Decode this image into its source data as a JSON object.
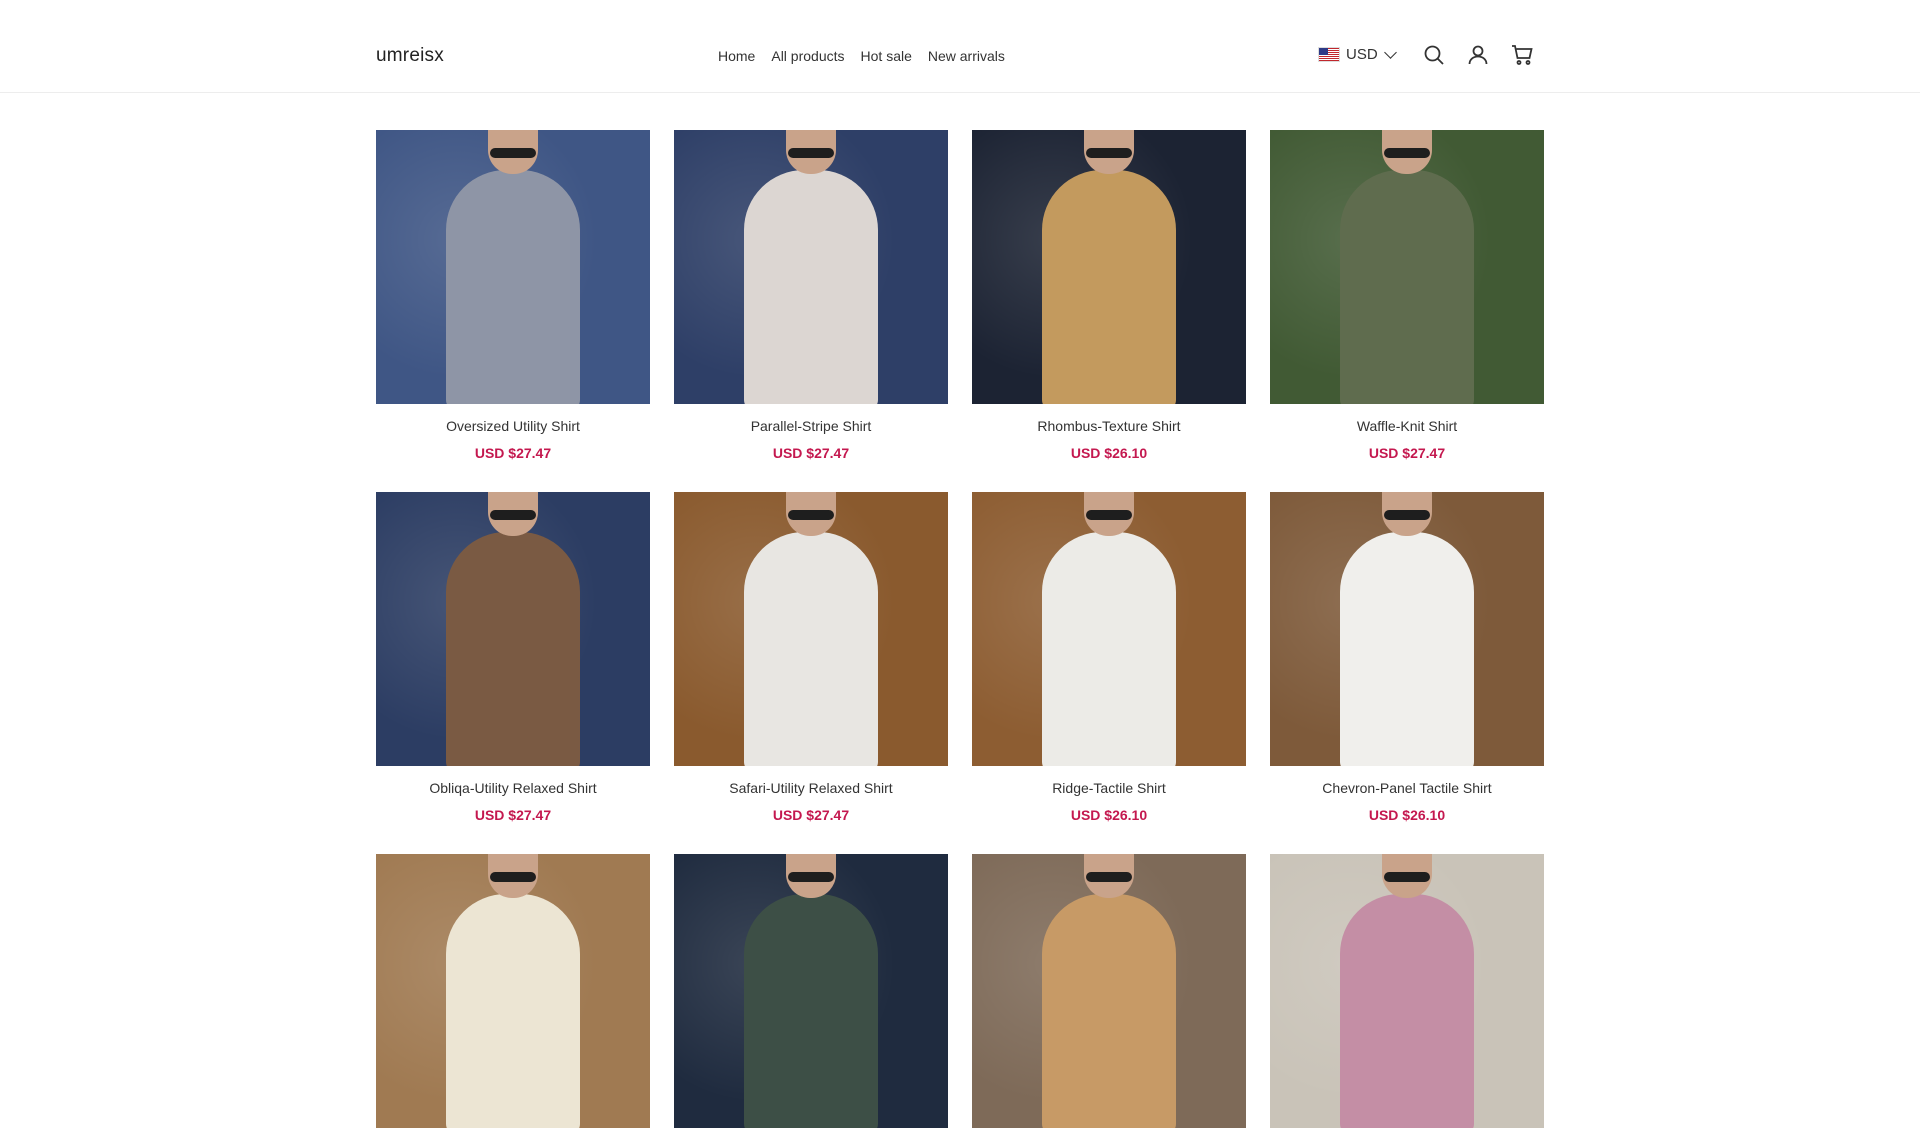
{
  "header": {
    "logo": "umreisx",
    "nav": [
      "Home",
      "All products",
      "Hot sale",
      "New arrivals"
    ],
    "currency": "USD"
  },
  "products": [
    {
      "name": "Oversized Utility Shirt",
      "price": "USD $27.47",
      "bg": "#3f5685",
      "shirt": "#8e95a6"
    },
    {
      "name": "Parallel-Stripe Shirt",
      "price": "USD $27.47",
      "bg": "#2e3f67",
      "shirt": "#dcd6d2"
    },
    {
      "name": "Rhombus-Texture Shirt",
      "price": "USD $26.10",
      "bg": "#1c2333",
      "shirt": "#c39a5e"
    },
    {
      "name": "Waffle-Knit Shirt",
      "price": "USD $27.47",
      "bg": "#415a34",
      "shirt": "#5f6c4e"
    },
    {
      "name": "Obliqa-Utility Relaxed Shirt",
      "price": "USD $27.47",
      "bg": "#2c3d63",
      "shirt": "#7a5a43"
    },
    {
      "name": "Safari-Utility Relaxed Shirt",
      "price": "USD $27.47",
      "bg": "#8a5a2e",
      "shirt": "#e8e6e2"
    },
    {
      "name": "Ridge-Tactile Shirt",
      "price": "USD $26.10",
      "bg": "#8d5d32",
      "shirt": "#ecebe7"
    },
    {
      "name": "Chevron-Panel Tactile Shirt",
      "price": "USD $26.10",
      "bg": "#7e5a3a",
      "shirt": "#f0efec"
    },
    {
      "name": "",
      "price": "",
      "bg": "#a07a52",
      "shirt": "#ece5d3"
    },
    {
      "name": "",
      "price": "",
      "bg": "#1f2b3f",
      "shirt": "#3d4f46"
    },
    {
      "name": "",
      "price": "",
      "bg": "#7e6a58",
      "shirt": "#c79a66"
    },
    {
      "name": "",
      "price": "",
      "bg": "#c9c3b8",
      "shirt": "#c48ea5"
    }
  ]
}
